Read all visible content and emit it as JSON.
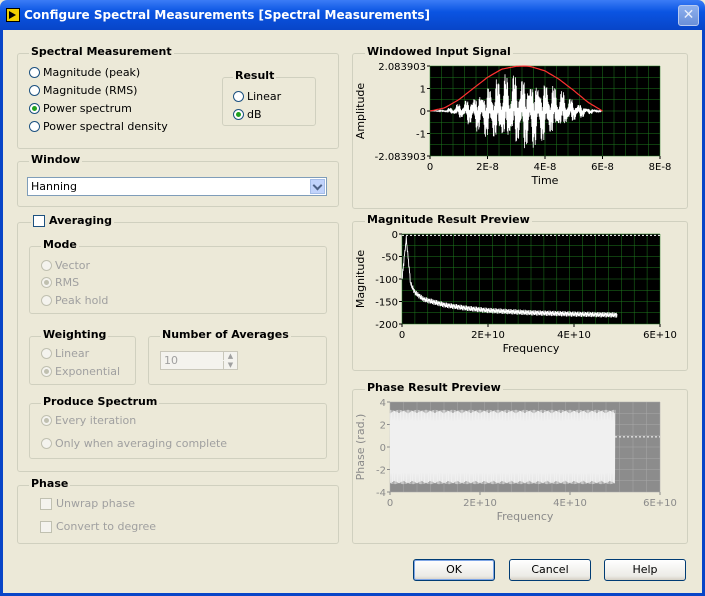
{
  "window": {
    "title": "Configure Spectral Measurements [Spectral Measurements]"
  },
  "spectral_measurement": {
    "label": "Spectral Measurement",
    "options": [
      "Magnitude (peak)",
      "Magnitude (RMS)",
      "Power spectrum",
      "Power spectral density"
    ],
    "selected": "Power spectrum"
  },
  "result": {
    "label": "Result",
    "options": [
      "Linear",
      "dB"
    ],
    "selected": "dB"
  },
  "window_section": {
    "label": "Window",
    "value": "Hanning"
  },
  "averaging": {
    "label": "Averaging",
    "checked": false,
    "mode": {
      "label": "Mode",
      "options": [
        "Vector",
        "RMS",
        "Peak hold"
      ],
      "selected": "RMS"
    },
    "weighting": {
      "label": "Weighting",
      "options": [
        "Linear",
        "Exponential"
      ],
      "selected": "Exponential"
    },
    "number_of_averages": {
      "label": "Number of Averages",
      "value": "10"
    },
    "produce_spectrum": {
      "label": "Produce Spectrum",
      "options": [
        "Every iteration",
        "Only when averaging complete"
      ],
      "selected": "Every iteration"
    }
  },
  "phase": {
    "label": "Phase",
    "options": [
      "Unwrap phase",
      "Convert to degree"
    ]
  },
  "buttons": {
    "ok": "OK",
    "cancel": "Cancel",
    "help": "Help"
  },
  "colors": {
    "plot_bg": "#000000",
    "plot_grid": "#1e7a1e",
    "signal": "#ffffff",
    "window_curve": "#ff3030",
    "disabled_plot_bg": "#8c8c8c"
  },
  "chart_data": [
    {
      "type": "line",
      "title": "Windowed Input Signal",
      "xlabel": "Time",
      "ylabel": "Amplitude",
      "xlim": [
        0,
        8e-08
      ],
      "ylim": [
        -2.083903,
        2.083903
      ],
      "x_ticks": [
        "0",
        "2E-8",
        "4E-8",
        "6E-8",
        "8E-8"
      ],
      "y_ticks": [
        "2.083903",
        "1",
        "0",
        "-1",
        "-2.083903"
      ],
      "series": [
        {
          "color": "#ffffff",
          "x": [
            0,
            5e-09,
            1e-08,
            1.5e-08,
            2e-08,
            2.5e-08,
            3e-08,
            3.3e-08,
            3.5e-08,
            4e-08,
            4.5e-08,
            5e-08,
            5.5e-08,
            6e-08
          ],
          "y": [
            0,
            0.05,
            0.4,
            0.9,
            1.5,
            1.9,
            2.05,
            2.08,
            2.05,
            1.7,
            1.2,
            0.6,
            0.2,
            0
          ]
        },
        {
          "color": "#ff3030",
          "x": [
            0,
            5e-09,
            1e-08,
            1.5e-08,
            2e-08,
            2.5e-08,
            3e-08,
            3.3e-08,
            3.5e-08,
            4e-08,
            4.5e-08,
            5e-08,
            5.5e-08,
            6e-08
          ],
          "y": [
            0,
            0.14,
            0.52,
            1.04,
            1.56,
            1.94,
            2.07,
            2.08,
            2.06,
            1.86,
            1.46,
            0.95,
            0.4,
            0
          ]
        }
      ]
    },
    {
      "type": "line",
      "title": "Magnitude Result Preview",
      "xlabel": "Frequency",
      "ylabel": "Magnitude",
      "xlim": [
        0,
        60000000000.0
      ],
      "ylim": [
        -200,
        0
      ],
      "x_ticks": [
        "0",
        "2E+10",
        "4E+10",
        "6E+10"
      ],
      "y_ticks": [
        "0",
        "-50",
        "-100",
        "-150",
        "-200"
      ],
      "series": [
        {
          "color": "#ffffff",
          "x": [
            0,
            1000000000.0,
            2000000000.0,
            3000000000.0,
            5000000000.0,
            10000000000.0,
            15000000000.0,
            20000000000.0,
            30000000000.0,
            40000000000.0,
            50000000000.0
          ],
          "y": [
            -100,
            -10,
            -110,
            -130,
            -145,
            -158,
            -165,
            -170,
            -175,
            -178,
            -180
          ]
        }
      ]
    },
    {
      "type": "line",
      "title": "Phase Result Preview",
      "xlabel": "Frequency",
      "ylabel": "Phase (rad.)",
      "xlim": [
        0,
        60000000000.0
      ],
      "ylim": [
        -4,
        4
      ],
      "x_ticks": [
        "0",
        "2E+10",
        "4E+10",
        "6E+10"
      ],
      "y_ticks": [
        "4",
        "2",
        "0",
        "-2",
        "-4"
      ],
      "series": [
        {
          "color": "#f0f0f0",
          "x": [
            0,
            50000000000.0
          ],
          "y": [
            3.1,
            -3.1
          ]
        }
      ]
    }
  ]
}
